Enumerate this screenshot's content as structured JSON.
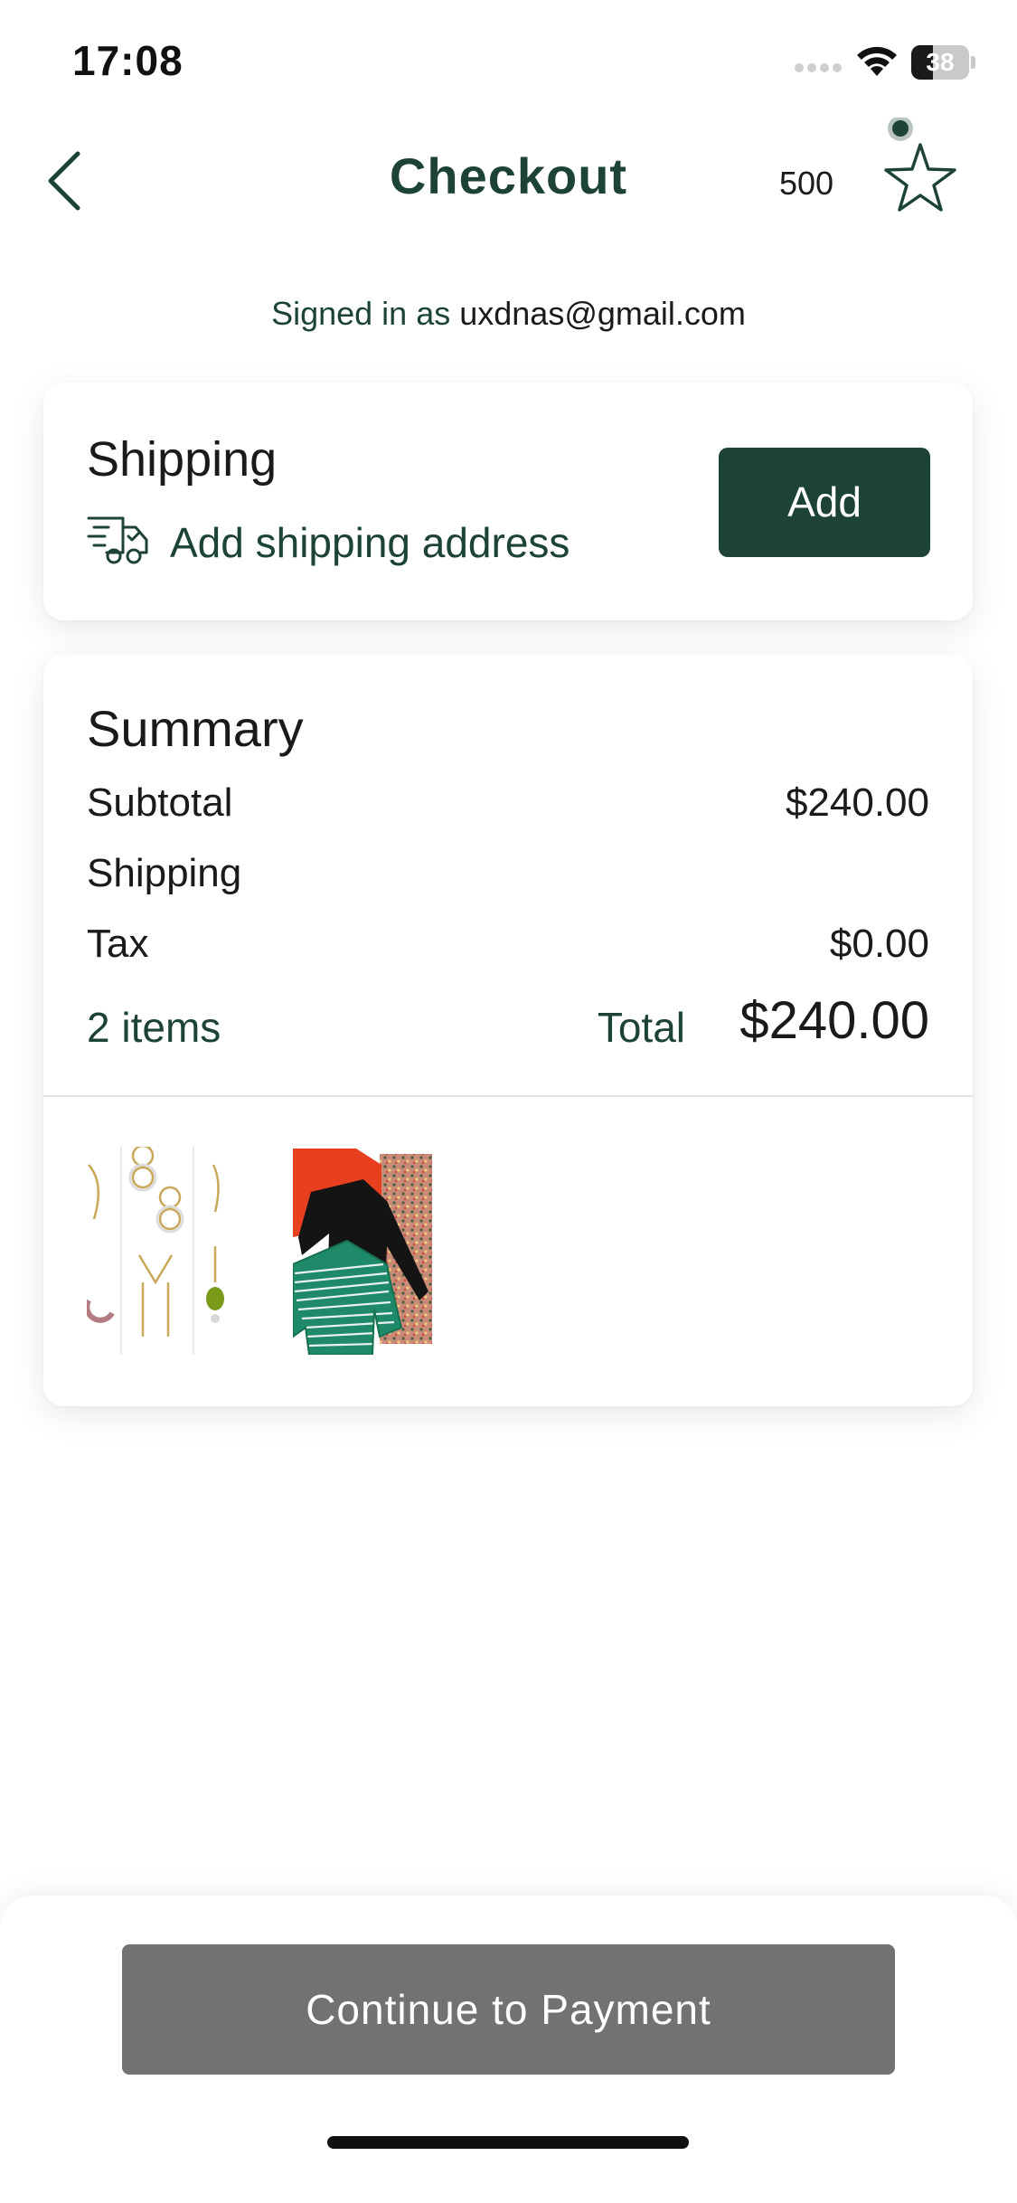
{
  "status_bar": {
    "time": "17:08",
    "battery_level": "38",
    "battery_fraction": 0.38
  },
  "nav": {
    "title": "Checkout",
    "points": "500",
    "back_icon": "chevron-left-icon",
    "favorites_icon": "star-icon"
  },
  "account": {
    "signed_in_prefix": "Signed in as",
    "email": "uxdnas@gmail.com"
  },
  "shipping": {
    "title": "Shipping",
    "address_label": "Add shipping address",
    "icon": "delivery-truck-icon",
    "add_button_label": "Add"
  },
  "summary": {
    "title": "Summary",
    "rows": [
      {
        "label": "Subtotal",
        "value": "$240.00"
      },
      {
        "label": "Shipping",
        "value": ""
      },
      {
        "label": "Tax",
        "value": "$0.00"
      }
    ],
    "items_count": "2 items",
    "total_label": "Total",
    "total_value": "$240.00"
  },
  "footer": {
    "continue_label": "Continue to Payment"
  },
  "colors": {
    "brand_green": "#1d4338",
    "disabled_button": "#727272",
    "background": "#ffffff",
    "divider": "#e2e2e2"
  }
}
